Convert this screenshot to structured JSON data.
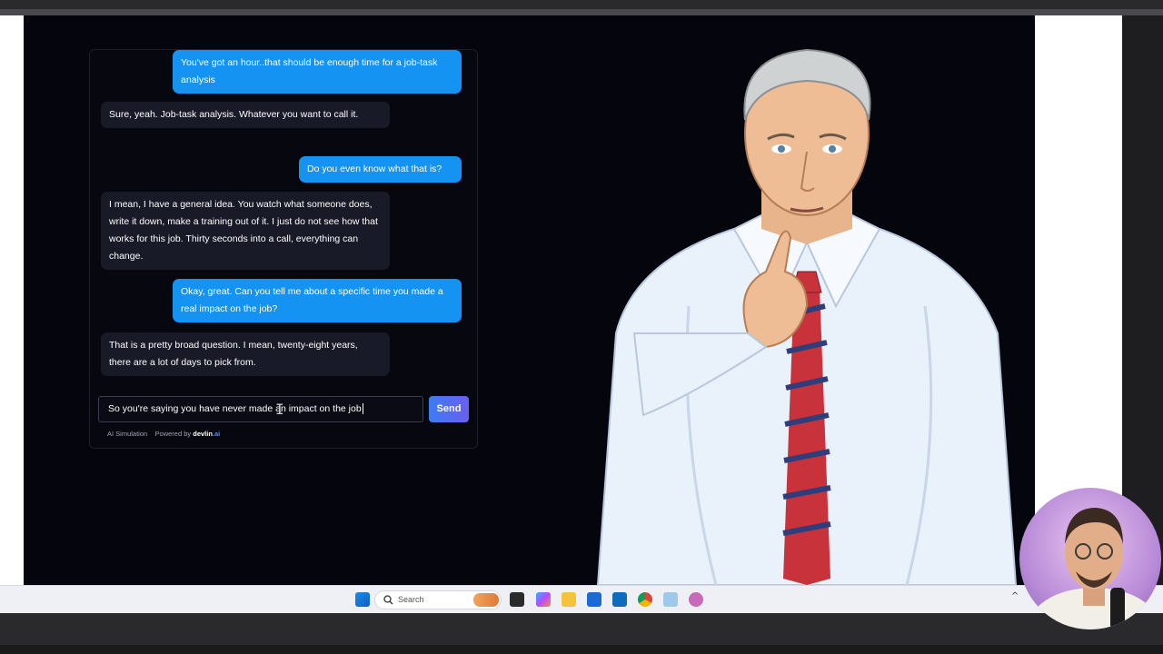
{
  "chat": {
    "messages": [
      {
        "role": "user",
        "text": "You've got an hour..that should be enough time for a job-task analysis"
      },
      {
        "role": "ai",
        "text": "Sure, yeah. Job-task analysis. Whatever you want to call it."
      },
      {
        "role": "user",
        "text": "Do you even know what that is?"
      },
      {
        "role": "ai",
        "text": "I mean, I have a general idea. You watch what someone does, write it down, make a training out of it. I just do not see how that works for this job. Thirty seconds into a call, everything can change."
      },
      {
        "role": "user",
        "text": "Okay, great. Can you tell me about a specific time you made a real impact on the job?"
      },
      {
        "role": "ai",
        "text": "That is a pretty broad question. I mean, twenty-eight years, there are a lot of days to pick from."
      }
    ],
    "input_value": "So you're saying you have never made an impact on the job",
    "send_label": "Send",
    "footer_left": "AI Simulation",
    "footer_powered": "Powered by",
    "footer_brand": "devlin",
    "footer_brand_suffix": ".ai"
  },
  "taskbar": {
    "search_placeholder": "Search",
    "icons": [
      "windows-start-icon",
      "search-icon",
      "widget-icon",
      "task-view-icon",
      "copilot-icon",
      "file-explorer-icon",
      "store-icon",
      "outlook-icon",
      "chrome-icon",
      "app-icon",
      "slack-icon"
    ]
  },
  "colors": {
    "user_bubble": "#1593f2",
    "ai_bubble": "#191a28",
    "background": "#05060d",
    "send_gradient_start": "#3d7cf2",
    "send_gradient_end": "#6a5ff0"
  }
}
